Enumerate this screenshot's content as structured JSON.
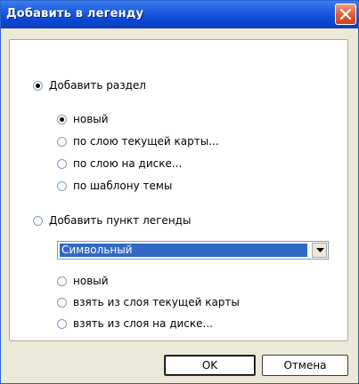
{
  "window": {
    "title": "Добавить в легенду"
  },
  "section": {
    "label": "Добавить раздел",
    "checked": true,
    "options": [
      {
        "label": "новый",
        "checked": true
      },
      {
        "label": "по слою текущей карты...",
        "checked": false
      },
      {
        "label": "по слою на диске...",
        "checked": false
      },
      {
        "label": "по шаблону темы",
        "checked": false
      }
    ]
  },
  "item": {
    "label": "Добавить пункт легенды",
    "checked": false,
    "dropdown_value": "Символьный",
    "options": [
      {
        "label": "новый",
        "checked": false
      },
      {
        "label": "взять из слоя текущей карты",
        "checked": false
      },
      {
        "label": "взять из слоя на диске...",
        "checked": false
      }
    ]
  },
  "buttons": {
    "ok": "OK",
    "cancel": "Отмена"
  },
  "icons": {
    "close": "close-icon",
    "dropdown": "chevron-down-icon"
  },
  "colors": {
    "titlebar": "#0a47d6",
    "close": "#e05b2e",
    "selection": "#316ac5",
    "dialog_bg": "#ece9d8"
  }
}
